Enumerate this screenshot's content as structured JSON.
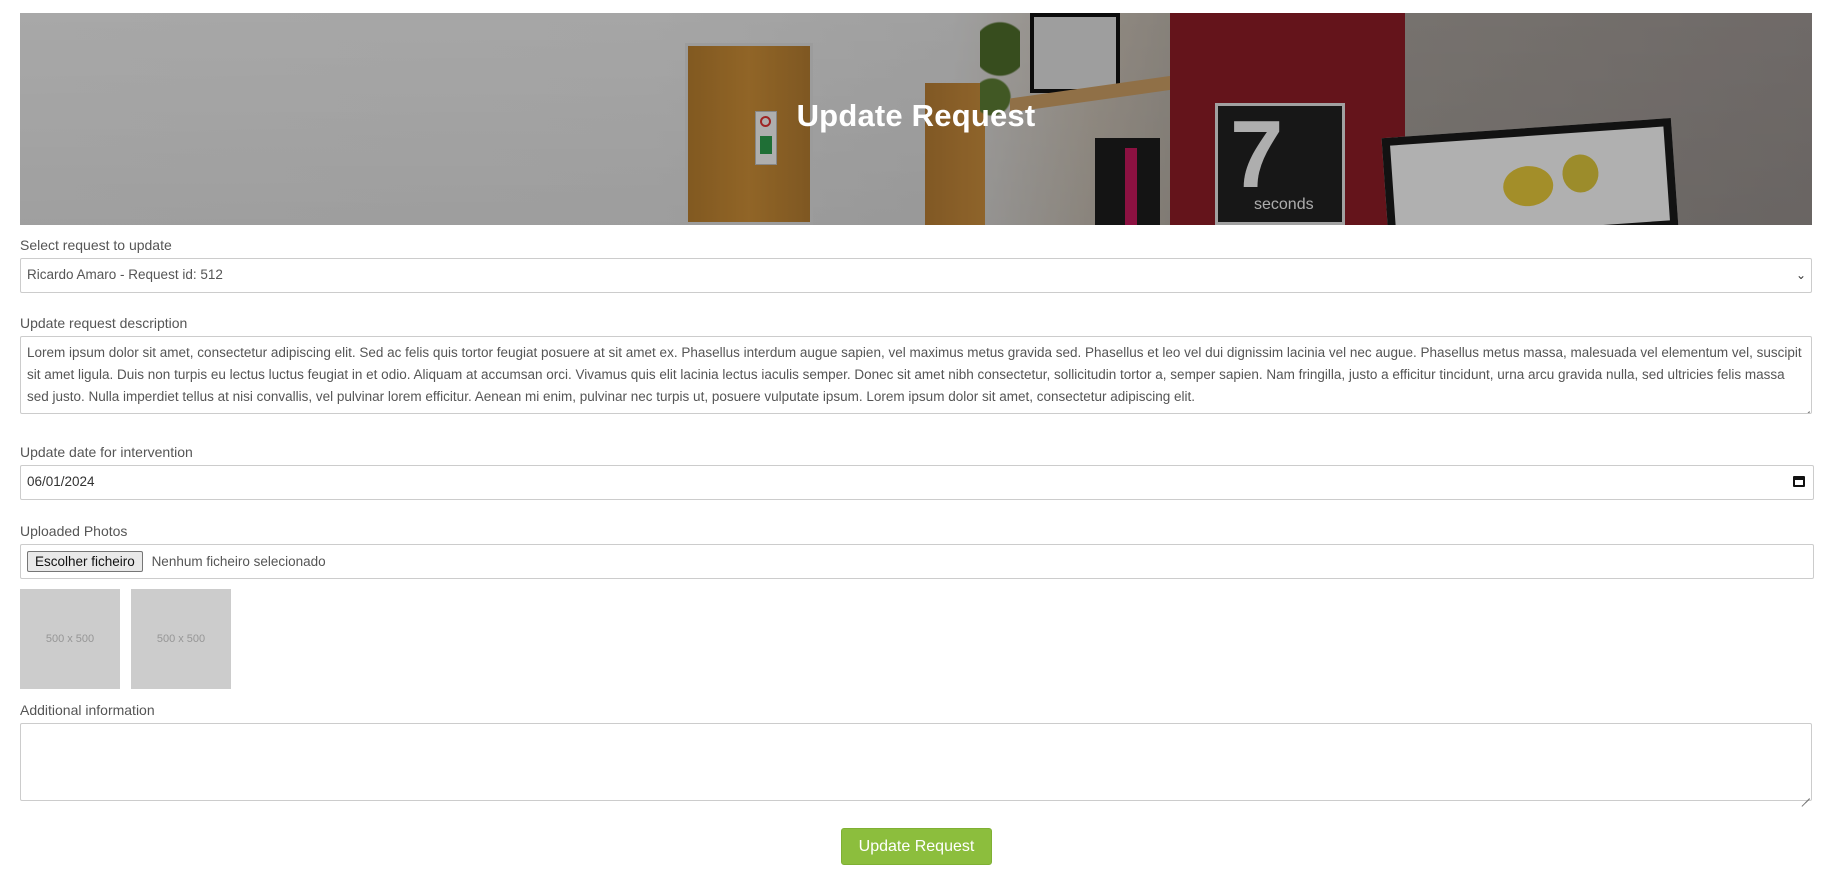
{
  "banner": {
    "title": "Update Request",
    "poster_number": "7",
    "poster_word": "seconds"
  },
  "form": {
    "request_select": {
      "label": "Select request to update",
      "selected": "Ricardo Amaro - Request id: 512"
    },
    "description": {
      "label": "Update request description",
      "value": "Lorem ipsum dolor sit amet, consectetur adipiscing elit. Sed ac felis quis tortor feugiat posuere at sit amet ex. Phasellus interdum augue sapien, vel maximus metus gravida sed. Phasellus et leo vel dui dignissim lacinia vel nec augue. Phasellus metus massa, malesuada vel elementum vel, suscipit sit amet ligula. Duis non turpis eu lectus luctus feugiat in et odio. Aliquam at accumsan orci. Vivamus quis elit lacinia lectus iaculis semper. Donec sit amet nibh consectetur, sollicitudin tortor a, semper sapien. Nam fringilla, justo a efficitur tincidunt, urna arcu gravida nulla, sed ultricies felis massa sed justo. Nulla imperdiet tellus at nisi convallis, vel pulvinar lorem efficitur. Aenean mi enim, pulvinar nec turpis ut, posuere vulputate ipsum. Lorem ipsum dolor sit amet, consectetur adipiscing elit."
    },
    "date": {
      "label": "Update date for intervention",
      "value": "06/01/2024"
    },
    "photos": {
      "label": "Uploaded Photos",
      "choose_button": "Escolher ficheiro",
      "status": "Nenhum ficheiro selecionado",
      "thumbnails": [
        "500 x 500",
        "500 x 500"
      ]
    },
    "additional": {
      "label": "Additional information",
      "value": ""
    },
    "submit_label": "Update Request"
  },
  "colors": {
    "accent": "#8cbe3d",
    "border": "#cccccc",
    "thumb_bg": "#cccccc"
  }
}
